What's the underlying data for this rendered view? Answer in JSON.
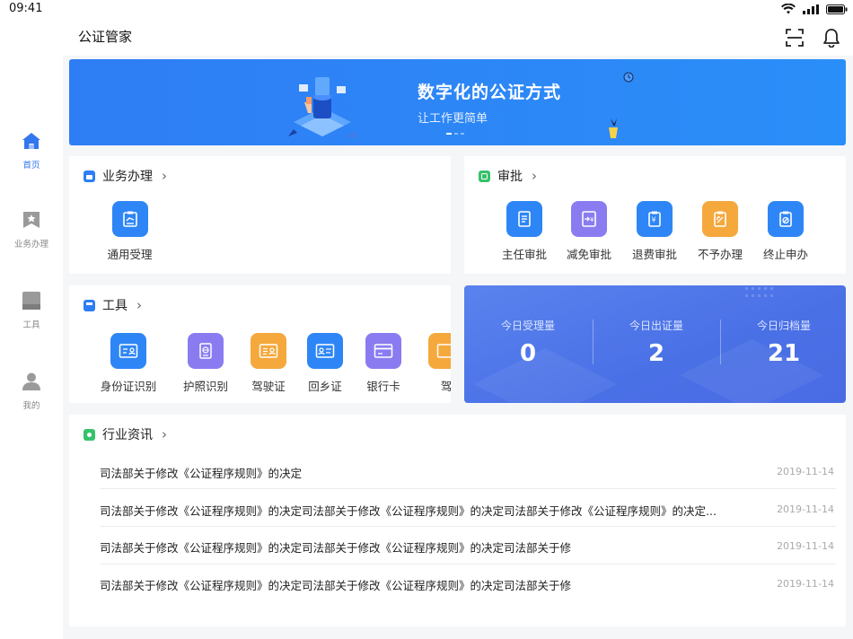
{
  "status_bar": {
    "time": "09:41"
  },
  "app": {
    "title": "公证管家"
  },
  "sidebar": {
    "items": [
      {
        "label": "首页",
        "icon": "home-icon",
        "active": true
      },
      {
        "label": "业务办理",
        "icon": "bookmark-icon",
        "active": false
      },
      {
        "label": "工具",
        "icon": "tool-icon",
        "active": false
      },
      {
        "label": "我的",
        "icon": "user-icon",
        "active": false
      }
    ]
  },
  "banner": {
    "title": "数字化的公证方式",
    "subtitle": "让工作更简单"
  },
  "business": {
    "title": "业务办理",
    "items": [
      {
        "label": "通用受理",
        "icon": "clipboard-icon"
      }
    ]
  },
  "approval": {
    "title": "审批",
    "items": [
      {
        "label": "主任审批",
        "icon": "document-icon"
      },
      {
        "label": "减免审批",
        "icon": "yuan-transfer-icon"
      },
      {
        "label": "退费审批",
        "icon": "yuan-refund-icon"
      },
      {
        "label": "不予办理",
        "icon": "reject-icon"
      },
      {
        "label": "终止申办",
        "icon": "stop-icon"
      }
    ]
  },
  "tools": {
    "title": "工具",
    "items": [
      {
        "label": "身份证识别",
        "icon": "id-card-icon"
      },
      {
        "label": "护照识别",
        "icon": "passport-icon"
      },
      {
        "label": "驾驶证",
        "icon": "driver-license-icon"
      },
      {
        "label": "回乡证",
        "icon": "return-permit-icon"
      },
      {
        "label": "银行卡",
        "icon": "bank-card-icon"
      },
      {
        "label": "驾",
        "icon": "driver-license-icon"
      }
    ]
  },
  "stats": [
    {
      "label": "今日受理量",
      "value": "0"
    },
    {
      "label": "今日出证量",
      "value": "2"
    },
    {
      "label": "今日归档量",
      "value": "21"
    }
  ],
  "news": {
    "title": "行业资讯",
    "items": [
      {
        "title": "司法部关于修改《公证程序规则》的决定",
        "date": "2019-11-14"
      },
      {
        "title": "司法部关于修改《公证程序规则》的决定司法部关于修改《公证程序规则》的决定司法部关于修改《公证程序规则》的决定...",
        "date": "2019-11-14"
      },
      {
        "title": "司法部关于修改《公证程序规则》的决定司法部关于修改《公证程序规则》的决定司法部关于修",
        "date": "2019-11-14"
      },
      {
        "title": "司法部关于修改《公证程序规则》的决定司法部关于修改《公证程序规则》的决定司法部关于修",
        "date": "2019-11-14"
      }
    ]
  },
  "colors": {
    "primary": "#2e7df4",
    "purple": "#8a7cf0",
    "orange": "#f5a83c",
    "green": "#37c26a",
    "stats_bg": "#4f73e8"
  }
}
